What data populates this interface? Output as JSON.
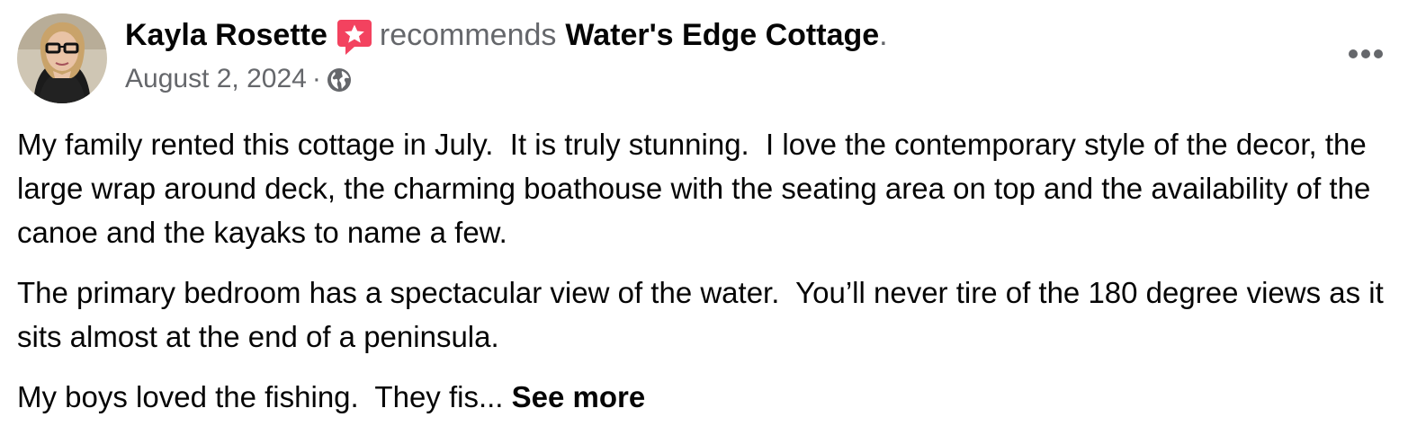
{
  "post": {
    "author": "Kayla Rosette",
    "recommend_verb": "recommends",
    "page_name": "Water's Edge Cottage",
    "period": ".",
    "date": "August 2, 2024",
    "separator": "·",
    "paragraphs": [
      "My family rented this cottage in July.  It is truly stunning.  I love the contemporary style of the decor, the large wrap around deck, the charming boathouse with the seating area on top and the availability of the canoe and the kayaks to name a few.",
      "The primary bedroom has a spectacular view of the water.  You’ll never tire of the 180 degree views as it sits almost at the end of a peninsula."
    ],
    "truncated_text": "My boys loved the fishing.  They fis... ",
    "see_more_label": "See more"
  },
  "icons": {
    "avatar": "profile-photo",
    "recommend": "recommend-star-icon",
    "privacy": "globe-icon",
    "menu": "more-options-icon"
  },
  "colors": {
    "text_primary": "#050505",
    "text_secondary": "#65676b",
    "recommend_badge": "#f3425f"
  }
}
